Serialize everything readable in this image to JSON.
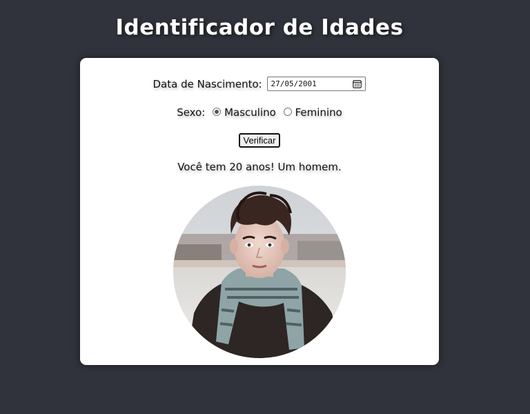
{
  "page": {
    "title": "Identificador de Idades"
  },
  "form": {
    "date_label": "Data de Nascimento:",
    "date_value": "27/05/2001",
    "sexo_label": "Sexo:",
    "options": [
      {
        "label": "Masculino",
        "checked": true
      },
      {
        "label": "Feminino",
        "checked": false
      }
    ],
    "button_label": "Verificar"
  },
  "result": {
    "text": "Você tem 20 anos! Um homem."
  },
  "icons": {
    "calendar": "calendar-icon"
  },
  "colors": {
    "background": "#30333b",
    "card": "#ffffff",
    "title": "#ffffff"
  }
}
